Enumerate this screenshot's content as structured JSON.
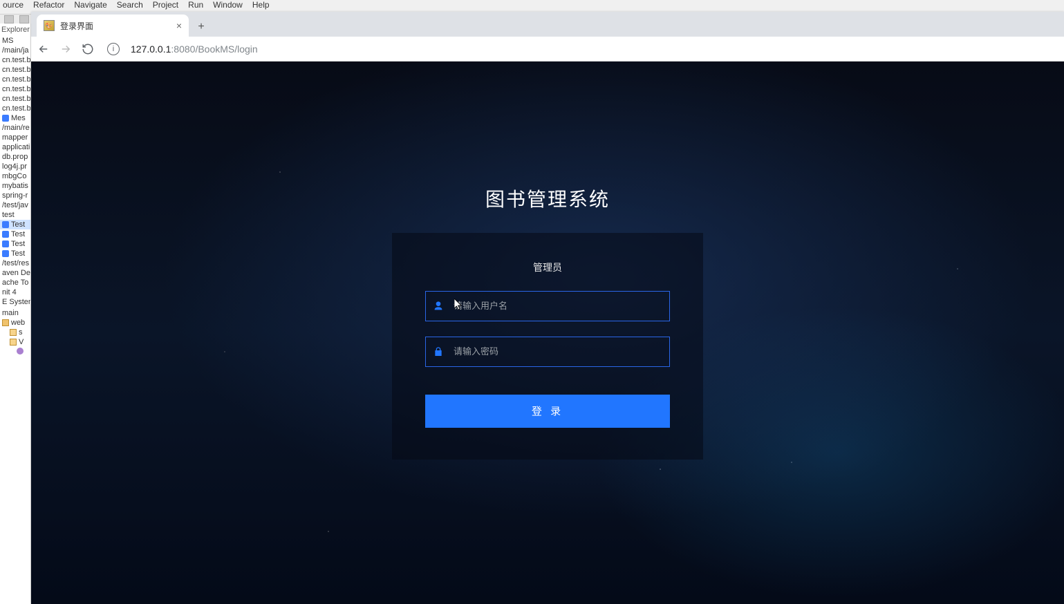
{
  "ide": {
    "menus": [
      "ource",
      "Refactor",
      "Navigate",
      "Search",
      "Project",
      "Run",
      "Window",
      "Help"
    ],
    "side_title": "Explorer",
    "side_items": [
      {
        "label": "MS",
        "ico": ""
      },
      {
        "label": "/main/ja",
        "ico": ""
      },
      {
        "label": "cn.test.b",
        "ico": ""
      },
      {
        "label": "cn.test.b",
        "ico": ""
      },
      {
        "label": "cn.test.b",
        "ico": ""
      },
      {
        "label": "cn.test.b",
        "ico": ""
      },
      {
        "label": "cn.test.b",
        "ico": ""
      },
      {
        "label": "cn.test.b",
        "ico": ""
      },
      {
        "label": "Mes",
        "ico": "j"
      },
      {
        "label": "/main/re",
        "ico": ""
      },
      {
        "label": "mapper",
        "ico": ""
      },
      {
        "label": "applicati",
        "ico": ""
      },
      {
        "label": "db.prop",
        "ico": ""
      },
      {
        "label": "log4j.pr",
        "ico": ""
      },
      {
        "label": "mbgCo",
        "ico": ""
      },
      {
        "label": "mybatis",
        "ico": ""
      },
      {
        "label": "spring-r",
        "ico": ""
      },
      {
        "label": "/test/jav",
        "ico": ""
      },
      {
        "label": "test",
        "ico": ""
      },
      {
        "label": "Test",
        "ico": "j",
        "sel": true
      },
      {
        "label": "Test",
        "ico": "j"
      },
      {
        "label": "Test",
        "ico": "j"
      },
      {
        "label": "Test",
        "ico": "j"
      },
      {
        "label": "/test/res",
        "ico": ""
      },
      {
        "label": "aven De",
        "ico": ""
      },
      {
        "label": "ache To",
        "ico": ""
      },
      {
        "label": "nit 4",
        "ico": ""
      },
      {
        "label": "E System",
        "ico": ""
      },
      {
        "label": "",
        "ico": ""
      },
      {
        "label": "main",
        "ico": ""
      },
      {
        "label": "web",
        "ico": "fld"
      },
      {
        "label": "s",
        "ico": "fld2",
        "child": true
      },
      {
        "label": "V",
        "ico": "fld2",
        "child": true
      },
      {
        "label": "",
        "ico": "cls",
        "child2": true
      }
    ]
  },
  "browser": {
    "tab_title": "登录界面",
    "close_glyph": "×",
    "newtab_glyph": "+",
    "url_host": "127.0.0.1",
    "url_port": ":8080",
    "url_path": "/BookMS/login",
    "info_glyph": "i"
  },
  "login": {
    "system_title": "图书管理系统",
    "role": "管理员",
    "username_placeholder": "请输入用户名",
    "password_placeholder": "请输入密码",
    "submit_label": "登 录"
  }
}
